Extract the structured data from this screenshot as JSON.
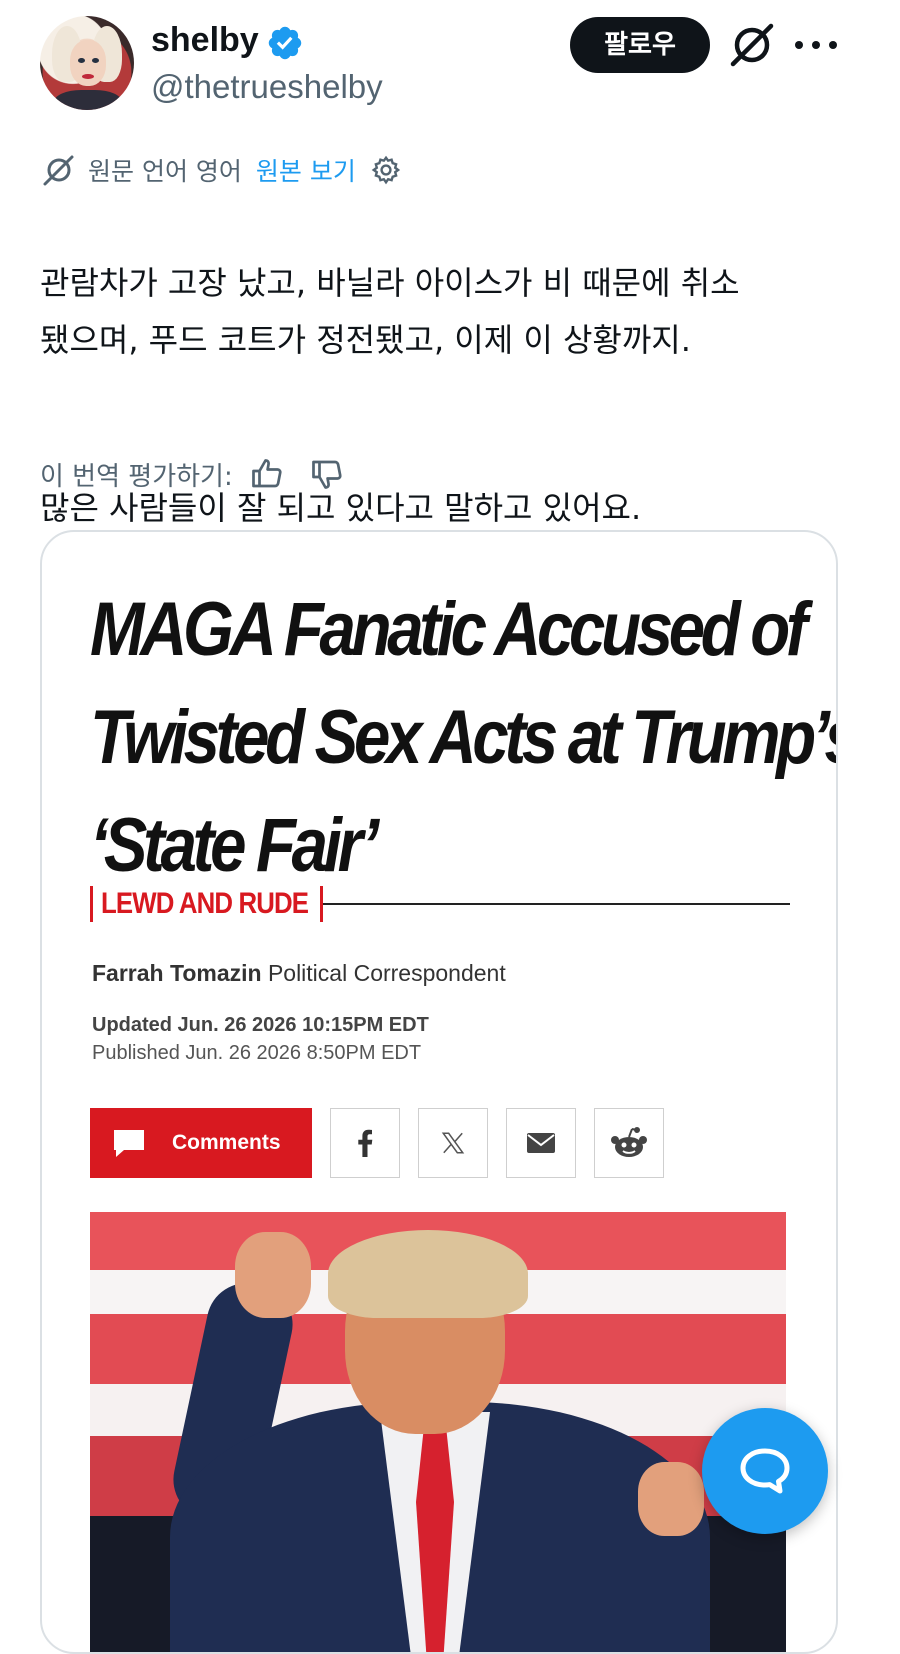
{
  "author": {
    "display_name": "shelby",
    "handle": "@thetrueshelby",
    "verified": true,
    "verified_color": "#1d9bf0"
  },
  "header": {
    "follow_label": "팔로우",
    "grok_icon": "grok-icon",
    "more_icon": "more-icon"
  },
  "translation": {
    "label": "원문 언어 영어",
    "show_original": "원본 보기",
    "settings_icon": "gear-icon",
    "rate_label": "이 번역 평가하기:",
    "like_icon": "thumbs-up-icon",
    "dislike_icon": "thumbs-down-icon"
  },
  "tweet": {
    "paragraphs": [
      "관람차가 고장 났고, 바닐라 아이스가 비 때문에 취소\n됐으며, 푸드 코트가 정전됐고, 이제 이 상황까지.",
      "많은 사람들이 잘 되고 있다고 말하고 있어요."
    ]
  },
  "media": {
    "headline_lines": [
      "MAGA Fanatic Accused of",
      "Twisted Sex Acts at Trump’s",
      "‘State Fair’"
    ],
    "kicker": "LEWD AND RUDE",
    "author_name": "Farrah Tomazin",
    "author_role": "Political Correspondent",
    "updated": "Updated Jun. 26 2026 10:15PM EDT",
    "published": "Published Jun. 26 2026 8:50PM EDT",
    "comments_label": "Comments",
    "share_icons": [
      "facebook-icon",
      "x-icon",
      "email-icon",
      "reddit-icon"
    ],
    "accent_color": "#d81920"
  },
  "fab": {
    "icon": "chat-bubble-icon",
    "color": "#1d9bf0"
  }
}
